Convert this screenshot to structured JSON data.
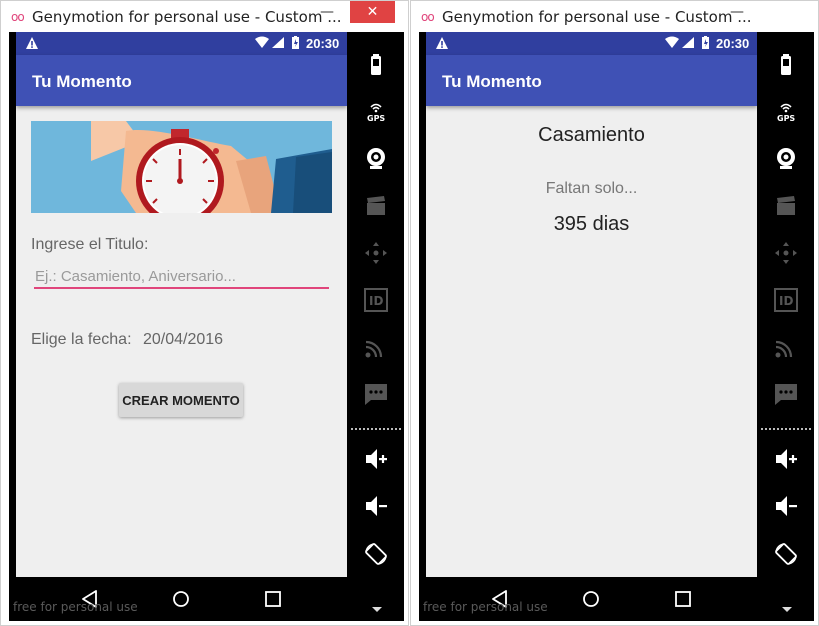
{
  "window_title": "Genymotion for personal use - Custom ...",
  "close_glyph": "✕",
  "minimize_glyph": "—",
  "app_icon_glyph": "oo",
  "status_time": "20:30",
  "app_title": "Tu Momento",
  "watermark": "free for personal use",
  "accent_color": "#3f51b5",
  "statusbar_color": "#303f9f",
  "input_accent_color": "#e0457b",
  "screen1": {
    "title_label": "Ingrese el Titulo:",
    "title_placeholder": "Ej.: Casamiento, Aniversario...",
    "title_value": "",
    "date_label": "Elige la fecha:",
    "date_value": "20/04/2016",
    "create_button": "CREAR MOMENTO"
  },
  "screen2": {
    "event_title": "Casamiento",
    "subtitle": "Faltan solo...",
    "days": "395 dias"
  },
  "sidebar_icons": [
    "battery-icon",
    "gps-icon",
    "webcam-icon",
    "video-capture-icon",
    "dpad-icon",
    "device-id-icon",
    "cast-icon",
    "sms-icon",
    "volume-up-icon",
    "volume-down-icon",
    "rotate-icon"
  ],
  "navbar_icons": [
    "back-icon",
    "home-icon",
    "recents-icon"
  ]
}
